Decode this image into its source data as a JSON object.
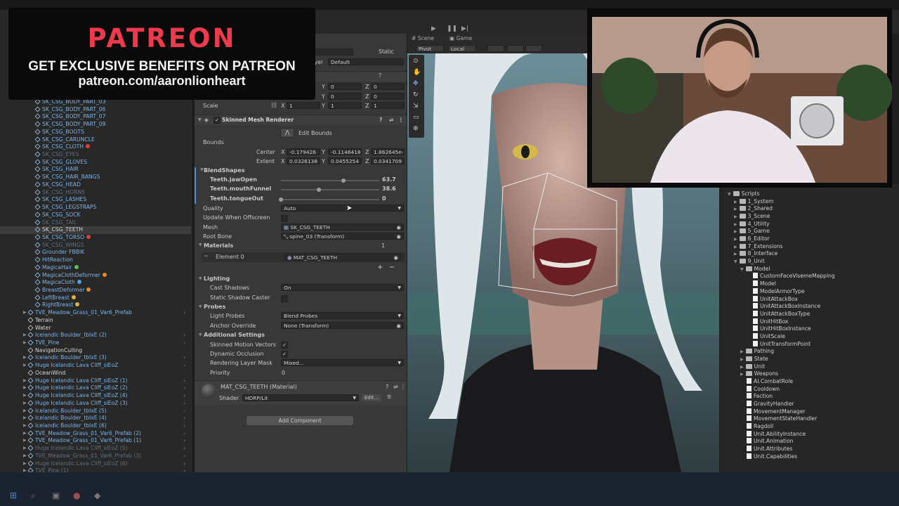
{
  "window_title": "",
  "toolbar": {
    "static_label": "Static",
    "layer_label": "ayer",
    "layer_value": "Default"
  },
  "hierarchy": {
    "items": [
      {
        "label": "SK_CSG_BODY_PART_03",
        "style": "blue"
      },
      {
        "label": "SK_CSG_BODY_PART_06",
        "style": "blue"
      },
      {
        "label": "SK_CSG_BODY_PART_07",
        "style": "blue"
      },
      {
        "label": "SK_CSG_BODY_PART_09",
        "style": "blue"
      },
      {
        "label": "SK_CSG_BOOTS",
        "style": "blue"
      },
      {
        "label": "SK_CSG_CARUNCLE",
        "style": "blue"
      },
      {
        "label": "SK_CSG_CLOTH",
        "style": "blue"
      },
      {
        "label": "SK_CSG_EYES",
        "style": "dim"
      },
      {
        "label": "SK_CSG_GLOVES",
        "style": "blue"
      },
      {
        "label": "SK_CSG_HAIR",
        "style": "blue"
      },
      {
        "label": "SK_CSG_HAIR_BANGS",
        "style": "blue"
      },
      {
        "label": "SK_CSG_HEAD",
        "style": "blue"
      },
      {
        "label": "SK_CSG_HORNS",
        "style": "dim"
      },
      {
        "label": "SK_CSG_LASHES",
        "style": "blue"
      },
      {
        "label": "SK_CSG_LEGSTRAPS",
        "style": "blue"
      },
      {
        "label": "SK_CSG_SOCK",
        "style": "blue"
      },
      {
        "label": "SK_CSG_TAIL",
        "style": "dim"
      },
      {
        "label": "SK_CSG_TEETH",
        "style": "sel"
      },
      {
        "label": "SK_CSG_TORSO",
        "style": "blue"
      },
      {
        "label": "SK_CSG_WINGS",
        "style": "dim"
      },
      {
        "label": "Grounder FBBIK",
        "style": "blue"
      },
      {
        "label": "HitReaction",
        "style": "blue"
      },
      {
        "label": "MagicaHair",
        "style": "blue"
      },
      {
        "label": "MagicaClothDeformer",
        "style": "blue"
      },
      {
        "label": "MagicaCloth",
        "style": "blue"
      },
      {
        "label": "BreastDeformer",
        "style": "blue"
      },
      {
        "label": "LeftBreast",
        "style": "blue"
      },
      {
        "label": "RightBreast",
        "style": "blue"
      },
      {
        "label": "TVE_Meadow_Grass_01_Var6_Prefab",
        "style": "blue"
      },
      {
        "label": "Terrain",
        "style": "white"
      },
      {
        "label": "Water",
        "style": "white"
      },
      {
        "label": "Icelandic Boulder_tblxE (2)",
        "style": "blue"
      },
      {
        "label": "TVE_Pine",
        "style": "blue"
      },
      {
        "label": "NavigationCulling",
        "style": "white"
      },
      {
        "label": "Icelandic Boulder_tblxE (3)",
        "style": "blue"
      },
      {
        "label": "Huge Icelandic Lava Cliff_siEoZ",
        "style": "blue"
      },
      {
        "label": "OceanWind",
        "style": "white"
      },
      {
        "label": "Huge Icelandic Lava Cliff_siEoZ (1)",
        "style": "blue"
      },
      {
        "label": "Huge Icelandic Lava Cliff_siEoZ (2)",
        "style": "blue"
      },
      {
        "label": "Huge Icelandic Lava Cliff_siEoZ (4)",
        "style": "blue"
      },
      {
        "label": "Huge Icelandic Lava Cliff_siEoZ (3)",
        "style": "blue"
      },
      {
        "label": "Icelandic Boulder_tblxE (5)",
        "style": "blue"
      },
      {
        "label": "Icelandic Boulder_tblxE (4)",
        "style": "blue"
      },
      {
        "label": "Icelandic Boulder_tblxE (6)",
        "style": "blue"
      },
      {
        "label": "TVE_Meadow_Grass_01_Var6_Prefab (2)",
        "style": "blue"
      },
      {
        "label": "TVE_Meadow_Grass_01_Var6_Prefab (1)",
        "style": "blue"
      },
      {
        "label": "Huge Icelandic Lava Cliff_siEoZ (5)",
        "style": "dim"
      },
      {
        "label": "TVE_Meadow_Grass_01_Var6_Prefab (3)",
        "style": "dim"
      },
      {
        "label": "Huge Icelandic Lava Cliff_siEoZ (6)",
        "style": "dim"
      },
      {
        "label": "TVE_Pine (1)",
        "style": "dim"
      }
    ]
  },
  "inspector": {
    "transform": {
      "y1_label": "Y",
      "y1": "0",
      "z1_label": "Z",
      "z1": "0",
      "y2": "0",
      "z2": "0",
      "scale_label": "Scale",
      "scale_x_label": "X",
      "scale_x": "1",
      "scale_y": "1",
      "scale_z": "1"
    },
    "renderer": {
      "title": "Skinned Mesh Renderer",
      "edit_bounds": "Edit Bounds",
      "bounds_label": "Bounds",
      "center_label": "Center",
      "center_x": "-0.179426",
      "center_y": "-0.1146418",
      "center_z": "1.862645e-",
      "extent_label": "Extent",
      "extent_x": "0.0326138",
      "extent_y": "0.0455254",
      "extent_z": "0.0341709",
      "blendshapes_label": "BlendShapes",
      "blendshapes": [
        {
          "name": "Teeth.jawOpen",
          "value": "63.7",
          "fraction": 0.637
        },
        {
          "name": "Teeth.mouthFunnel",
          "value": "38.6",
          "fraction": 0.386
        },
        {
          "name": "Teeth.tongueOut",
          "value": "0",
          "fraction": 0
        }
      ],
      "quality_label": "Quality",
      "quality_value": "Auto",
      "update_offscreen_label": "Update When Offscreen",
      "mesh_label": "Mesh",
      "mesh_value": "SK_CSG_TEETH",
      "rootbone_label": "Root Bone",
      "rootbone_value": "spine_03 (Transform)",
      "materials_label": "Materials",
      "materials_count": "1",
      "element0_label": "Element 0",
      "element0_value": "MAT_CSG_TEETH",
      "lighting_label": "Lighting",
      "cast_shadows_label": "Cast Shadows",
      "cast_shadows_value": "On",
      "static_shadow_label": "Static Shadow Caster",
      "probes_label": "Probes",
      "light_probes_label": "Light Probes",
      "light_probes_value": "Blend Probes",
      "anchor_label": "Anchor Override",
      "anchor_value": "None (Transform)",
      "additional_label": "Additional Settings",
      "skinned_motion_label": "Skinned Motion Vectors",
      "dynamic_occlusion_label": "Dynamic Occlusion",
      "rendering_mask_label": "Rendering Layer Mask",
      "rendering_mask_value": "Mixed...",
      "priority_label": "Priority",
      "priority_value": "0"
    },
    "material": {
      "title": "MAT_CSG_TEETH (Material)",
      "shader_label": "Shader",
      "shader_value": "HDRP/Lit",
      "edit_label": "Edit..."
    },
    "add_component": "Add Component"
  },
  "scene": {
    "tab_scene": "Scene",
    "tab_game": "Game",
    "pivot": "Pivot",
    "local": "Local"
  },
  "project": {
    "items": [
      {
        "label": "Scripts",
        "depth": 0,
        "kind": "folder",
        "open": true
      },
      {
        "label": "1_System",
        "depth": 1,
        "kind": "folder"
      },
      {
        "label": "2_Shared",
        "depth": 1,
        "kind": "folder"
      },
      {
        "label": "3_Scene",
        "depth": 1,
        "kind": "folder"
      },
      {
        "label": "4_Utility",
        "depth": 1,
        "kind": "folder"
      },
      {
        "label": "5_Game",
        "depth": 1,
        "kind": "folder"
      },
      {
        "label": "6_Editor",
        "depth": 1,
        "kind": "folder"
      },
      {
        "label": "7_Extensions",
        "depth": 1,
        "kind": "folder"
      },
      {
        "label": "8_Interface",
        "depth": 1,
        "kind": "folder"
      },
      {
        "label": "9_Unit",
        "depth": 1,
        "kind": "folder",
        "open": true
      },
      {
        "label": "Model",
        "depth": 2,
        "kind": "folder",
        "open": true
      },
      {
        "label": "CustomFaceVisemeMapping",
        "depth": 3,
        "kind": "script"
      },
      {
        "label": "Model",
        "depth": 3,
        "kind": "script"
      },
      {
        "label": "ModelArmorType",
        "depth": 3,
        "kind": "script"
      },
      {
        "label": "UnitAttackBox",
        "depth": 3,
        "kind": "script"
      },
      {
        "label": "UnitAttackBoxInstance",
        "depth": 3,
        "kind": "script"
      },
      {
        "label": "UnitAttackBoxType",
        "depth": 3,
        "kind": "script"
      },
      {
        "label": "UnitHitBox",
        "depth": 3,
        "kind": "script"
      },
      {
        "label": "UnitHitBoxInstance",
        "depth": 3,
        "kind": "script"
      },
      {
        "label": "UnitScale",
        "depth": 3,
        "kind": "script"
      },
      {
        "label": "UnitTransformPoint",
        "depth": 3,
        "kind": "script"
      },
      {
        "label": "Pathing",
        "depth": 2,
        "kind": "folder"
      },
      {
        "label": "State",
        "depth": 2,
        "kind": "folder"
      },
      {
        "label": "Unit",
        "depth": 2,
        "kind": "folder"
      },
      {
        "label": "Weapons",
        "depth": 2,
        "kind": "folder"
      },
      {
        "label": "AI.CombatRole",
        "depth": 2,
        "kind": "script"
      },
      {
        "label": "Cooldown",
        "depth": 2,
        "kind": "script"
      },
      {
        "label": "Faction",
        "depth": 2,
        "kind": "script"
      },
      {
        "label": "GravityHandler",
        "depth": 2,
        "kind": "script"
      },
      {
        "label": "MovementManager",
        "depth": 2,
        "kind": "script"
      },
      {
        "label": "MovementStateHandler",
        "depth": 2,
        "kind": "script"
      },
      {
        "label": "Ragdoll",
        "depth": 2,
        "kind": "script"
      },
      {
        "label": "Unit.AbilityInstance",
        "depth": 2,
        "kind": "script"
      },
      {
        "label": "Unit.Animation",
        "depth": 2,
        "kind": "script"
      },
      {
        "label": "Unit.Attributes",
        "depth": 2,
        "kind": "script"
      },
      {
        "label": "Unit.Capabilities",
        "depth": 2,
        "kind": "script"
      }
    ]
  },
  "patreon": {
    "logo": "PATREON",
    "line1": "GET EXCLUSIVE BENEFITS ON PATREON",
    "line2": "patreon.com/aaronlionheart",
    "accent": "#ef3a4e"
  }
}
